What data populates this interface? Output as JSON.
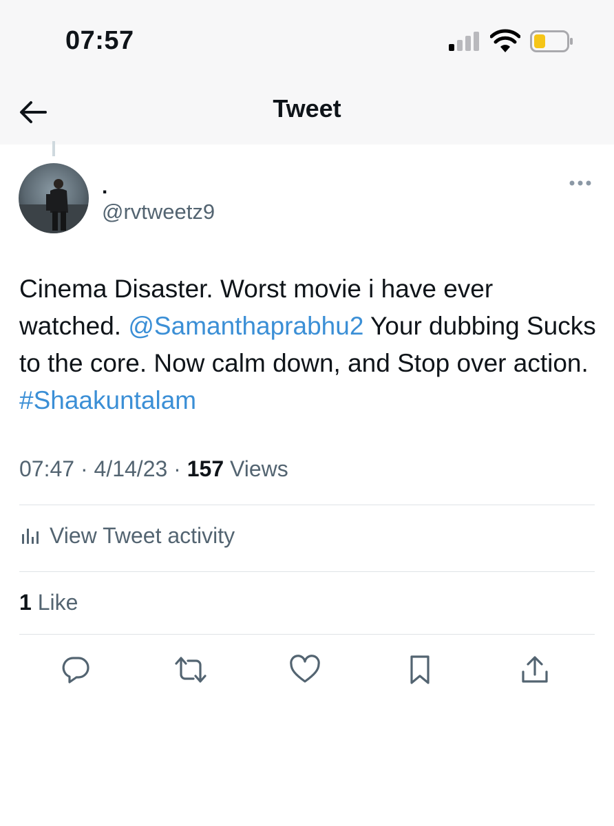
{
  "status_bar": {
    "time": "07:57",
    "signal_icon": "cellular-signal-icon",
    "wifi_icon": "wifi-icon",
    "battery_icon": "battery-low-icon",
    "battery_color": "#f5c518"
  },
  "nav": {
    "back_icon": "arrow-left-icon",
    "title": "Tweet"
  },
  "tweet": {
    "author": {
      "display_name": ".",
      "handle": "@rvtweetz9"
    },
    "text_parts": {
      "p1": "Cinema Disaster. Worst movie i have ever watched. ",
      "mention": "@Samanthaprabhu2",
      "p2": " Your dubbing Sucks to the core. Now calm down, and Stop over action. ",
      "hashtag": "#Shaakuntalam"
    },
    "time": "07:47",
    "sep1": " · ",
    "date": "4/14/23",
    "sep2": " · ",
    "views_count": "157",
    "views_label": " Views",
    "activity_label": "View Tweet activity",
    "likes_count": "1",
    "likes_label": " Like"
  },
  "actions": [
    "reply-icon",
    "retweet-icon",
    "like-icon",
    "bookmark-icon",
    "share-icon"
  ],
  "colors": {
    "link": "#3b8fd6",
    "secondary_text": "#536471",
    "divider": "#dfe3e6"
  }
}
